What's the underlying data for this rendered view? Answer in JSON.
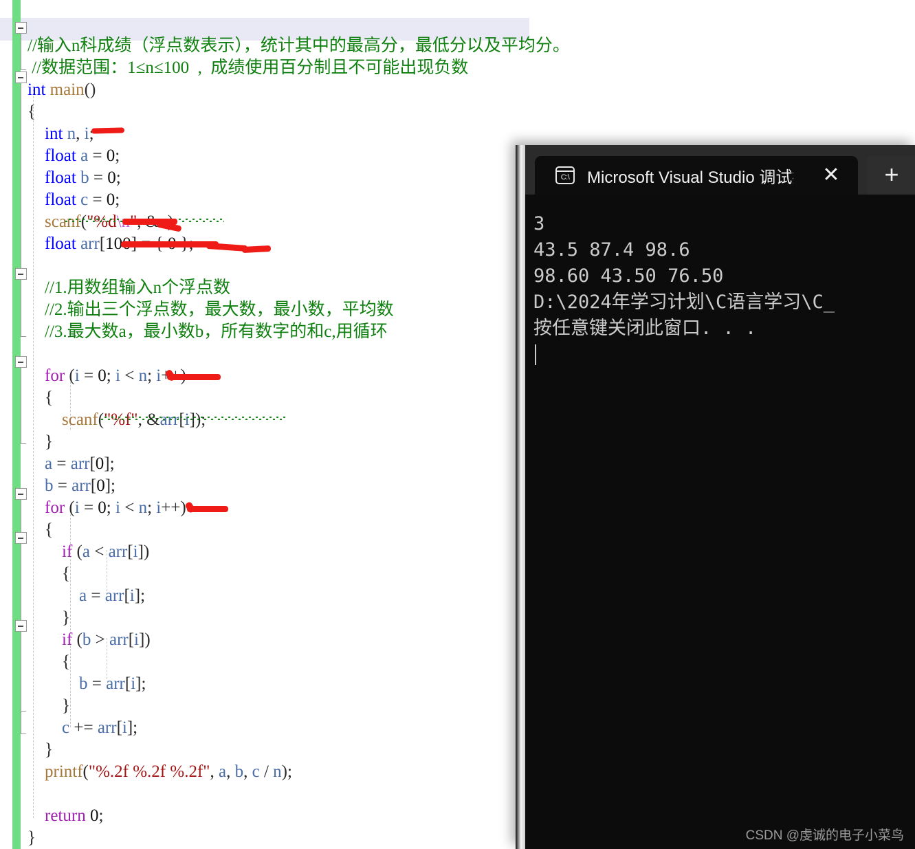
{
  "editor": {
    "name": "visual-studio-code-editor",
    "lines": [
      {
        "indent": 0,
        "tokens": [
          {
            "t": "cmt",
            "s": "//输入n科成绩（浮点数表示），统计其中的最高分，最低分以及平均分。"
          }
        ]
      },
      {
        "indent": 0,
        "tokens": [
          {
            "t": "cmt",
            "s": " //数据范围：1≤n≤100  ,  成绩使用百分制且不可能出现负数"
          }
        ]
      },
      {
        "indent": 0,
        "tokens": [
          {
            "t": "kw",
            "s": "int"
          },
          {
            "t": "fn",
            "s": " main"
          },
          {
            "t": "pun",
            "s": "()"
          }
        ]
      },
      {
        "indent": 0,
        "tokens": [
          {
            "t": "pun",
            "s": "{"
          }
        ]
      },
      {
        "indent": 0,
        "tokens": [
          {
            "t": "kw",
            "s": "    int"
          },
          {
            "t": "var",
            "s": " n"
          },
          {
            "t": "pun",
            "s": ","
          },
          {
            "t": "var",
            "s": " i"
          },
          {
            "t": "pun",
            "s": ";"
          }
        ]
      },
      {
        "indent": 0,
        "tokens": [
          {
            "t": "kw",
            "s": "    float"
          },
          {
            "t": "var",
            "s": " a"
          },
          {
            "t": "pun",
            "s": " = "
          },
          {
            "t": "num",
            "s": "0"
          },
          {
            "t": "pun",
            "s": ";"
          }
        ]
      },
      {
        "indent": 0,
        "tokens": [
          {
            "t": "kw",
            "s": "    float"
          },
          {
            "t": "var",
            "s": " b"
          },
          {
            "t": "pun",
            "s": " = "
          },
          {
            "t": "num",
            "s": "0"
          },
          {
            "t": "pun",
            "s": ";"
          }
        ]
      },
      {
        "indent": 0,
        "tokens": [
          {
            "t": "kw",
            "s": "    float"
          },
          {
            "t": "var",
            "s": " c"
          },
          {
            "t": "pun",
            "s": " = "
          },
          {
            "t": "num",
            "s": "0"
          },
          {
            "t": "pun",
            "s": ";"
          }
        ]
      },
      {
        "indent": 0,
        "tokens": [
          {
            "t": "fn",
            "s": "    scanf"
          },
          {
            "t": "pun",
            "s": "("
          },
          {
            "t": "str",
            "s": "\"%d"
          },
          {
            "t": "esc",
            "s": "\\n"
          },
          {
            "t": "str",
            "s": "\""
          },
          {
            "t": "pun",
            "s": ", &"
          },
          {
            "t": "var",
            "s": "n"
          },
          {
            "t": "pun",
            "s": ");"
          }
        ]
      },
      {
        "indent": 0,
        "tokens": [
          {
            "t": "kw",
            "s": "    float"
          },
          {
            "t": "var",
            "s": " arr"
          },
          {
            "t": "pun",
            "s": "["
          },
          {
            "t": "num",
            "s": "100"
          },
          {
            "t": "pun",
            "s": "] = { "
          },
          {
            "t": "num",
            "s": "0"
          },
          {
            "t": "pun",
            "s": " };"
          }
        ]
      },
      {
        "indent": 0,
        "tokens": []
      },
      {
        "indent": 0,
        "tokens": [
          {
            "t": "cmt",
            "s": "    //1.用数组输入n个浮点数"
          }
        ]
      },
      {
        "indent": 0,
        "tokens": [
          {
            "t": "cmt",
            "s": "    //2.输出三个浮点数，最大数，最小数，平均数"
          }
        ]
      },
      {
        "indent": 0,
        "tokens": [
          {
            "t": "cmt",
            "s": "    //3.最大数a，最小数b，所有数字的和c,用循环"
          }
        ]
      },
      {
        "indent": 0,
        "tokens": []
      },
      {
        "indent": 0,
        "tokens": [
          {
            "t": "ctl",
            "s": "    for"
          },
          {
            "t": "pun",
            "s": " ("
          },
          {
            "t": "var",
            "s": "i"
          },
          {
            "t": "pun",
            "s": " = "
          },
          {
            "t": "num",
            "s": "0"
          },
          {
            "t": "pun",
            "s": "; "
          },
          {
            "t": "var",
            "s": "i"
          },
          {
            "t": "pun",
            "s": " < "
          },
          {
            "t": "var",
            "s": "n"
          },
          {
            "t": "pun",
            "s": "; "
          },
          {
            "t": "var",
            "s": "i"
          },
          {
            "t": "pun",
            "s": "++)"
          }
        ]
      },
      {
        "indent": 0,
        "tokens": [
          {
            "t": "pun",
            "s": "    {"
          }
        ]
      },
      {
        "indent": 0,
        "tokens": [
          {
            "t": "fn",
            "s": "        scanf"
          },
          {
            "t": "pun",
            "s": "("
          },
          {
            "t": "str",
            "s": "\"%f\""
          },
          {
            "t": "pun",
            "s": ", &"
          },
          {
            "t": "var",
            "s": "arr"
          },
          {
            "t": "pun",
            "s": "["
          },
          {
            "t": "var",
            "s": "i"
          },
          {
            "t": "pun",
            "s": "]);"
          }
        ]
      },
      {
        "indent": 0,
        "tokens": [
          {
            "t": "pun",
            "s": "    }"
          }
        ]
      },
      {
        "indent": 0,
        "tokens": [
          {
            "t": "var",
            "s": "    a"
          },
          {
            "t": "pun",
            "s": " = "
          },
          {
            "t": "var",
            "s": "arr"
          },
          {
            "t": "pun",
            "s": "["
          },
          {
            "t": "num",
            "s": "0"
          },
          {
            "t": "pun",
            "s": "];"
          }
        ]
      },
      {
        "indent": 0,
        "tokens": [
          {
            "t": "var",
            "s": "    b"
          },
          {
            "t": "pun",
            "s": " = "
          },
          {
            "t": "var",
            "s": "arr"
          },
          {
            "t": "pun",
            "s": "["
          },
          {
            "t": "num",
            "s": "0"
          },
          {
            "t": "pun",
            "s": "];"
          }
        ]
      },
      {
        "indent": 0,
        "tokens": [
          {
            "t": "ctl",
            "s": "    for"
          },
          {
            "t": "pun",
            "s": " ("
          },
          {
            "t": "var",
            "s": "i"
          },
          {
            "t": "pun",
            "s": " = "
          },
          {
            "t": "num",
            "s": "0"
          },
          {
            "t": "pun",
            "s": "; "
          },
          {
            "t": "var",
            "s": "i"
          },
          {
            "t": "pun",
            "s": " < "
          },
          {
            "t": "var",
            "s": "n"
          },
          {
            "t": "pun",
            "s": "; "
          },
          {
            "t": "var",
            "s": "i"
          },
          {
            "t": "pun",
            "s": "++)"
          }
        ]
      },
      {
        "indent": 0,
        "tokens": [
          {
            "t": "pun",
            "s": "    {"
          }
        ]
      },
      {
        "indent": 0,
        "tokens": [
          {
            "t": "ctl",
            "s": "        if"
          },
          {
            "t": "pun",
            "s": " ("
          },
          {
            "t": "var",
            "s": "a"
          },
          {
            "t": "pun",
            "s": " < "
          },
          {
            "t": "var",
            "s": "arr"
          },
          {
            "t": "pun",
            "s": "["
          },
          {
            "t": "var",
            "s": "i"
          },
          {
            "t": "pun",
            "s": "])"
          }
        ]
      },
      {
        "indent": 0,
        "tokens": [
          {
            "t": "pun",
            "s": "        {"
          }
        ]
      },
      {
        "indent": 0,
        "tokens": [
          {
            "t": "var",
            "s": "            a"
          },
          {
            "t": "pun",
            "s": " = "
          },
          {
            "t": "var",
            "s": "arr"
          },
          {
            "t": "pun",
            "s": "["
          },
          {
            "t": "var",
            "s": "i"
          },
          {
            "t": "pun",
            "s": "];"
          }
        ]
      },
      {
        "indent": 0,
        "tokens": [
          {
            "t": "pun",
            "s": "        }"
          }
        ]
      },
      {
        "indent": 0,
        "tokens": [
          {
            "t": "ctl",
            "s": "        if"
          },
          {
            "t": "pun",
            "s": " ("
          },
          {
            "t": "var",
            "s": "b"
          },
          {
            "t": "pun",
            "s": " > "
          },
          {
            "t": "var",
            "s": "arr"
          },
          {
            "t": "pun",
            "s": "["
          },
          {
            "t": "var",
            "s": "i"
          },
          {
            "t": "pun",
            "s": "])"
          }
        ]
      },
      {
        "indent": 0,
        "tokens": [
          {
            "t": "pun",
            "s": "        {"
          }
        ]
      },
      {
        "indent": 0,
        "tokens": [
          {
            "t": "var",
            "s": "            b"
          },
          {
            "t": "pun",
            "s": " = "
          },
          {
            "t": "var",
            "s": "arr"
          },
          {
            "t": "pun",
            "s": "["
          },
          {
            "t": "var",
            "s": "i"
          },
          {
            "t": "pun",
            "s": "];"
          }
        ]
      },
      {
        "indent": 0,
        "tokens": [
          {
            "t": "pun",
            "s": "        }"
          }
        ]
      },
      {
        "indent": 0,
        "tokens": [
          {
            "t": "var",
            "s": "        c"
          },
          {
            "t": "pun",
            "s": " += "
          },
          {
            "t": "var",
            "s": "arr"
          },
          {
            "t": "pun",
            "s": "["
          },
          {
            "t": "var",
            "s": "i"
          },
          {
            "t": "pun",
            "s": "];"
          }
        ]
      },
      {
        "indent": 0,
        "tokens": [
          {
            "t": "pun",
            "s": "    }"
          }
        ]
      },
      {
        "indent": 0,
        "tokens": [
          {
            "t": "fn",
            "s": "    printf"
          },
          {
            "t": "pun",
            "s": "("
          },
          {
            "t": "str",
            "s": "\"%.2f %.2f %.2f\""
          },
          {
            "t": "pun",
            "s": ", "
          },
          {
            "t": "var",
            "s": "a"
          },
          {
            "t": "pun",
            "s": ", "
          },
          {
            "t": "var",
            "s": "b"
          },
          {
            "t": "pun",
            "s": ", "
          },
          {
            "t": "var",
            "s": "c"
          },
          {
            "t": "pun",
            "s": " / "
          },
          {
            "t": "var",
            "s": "n"
          },
          {
            "t": "pun",
            "s": ");"
          }
        ]
      },
      {
        "indent": 0,
        "tokens": []
      },
      {
        "indent": 0,
        "tokens": [
          {
            "t": "ctl",
            "s": "    return"
          },
          {
            "t": "num",
            "s": " 0"
          },
          {
            "t": "pun",
            "s": ";"
          }
        ]
      },
      {
        "indent": 0,
        "tokens": [
          {
            "t": "pun",
            "s": "}"
          }
        ]
      }
    ],
    "colors": {
      "comment": "#108010",
      "keyword": "#0000ff",
      "control": "#a020b0",
      "string": "#a31515",
      "function": "#a8783b",
      "variable": "#4b6ea8",
      "change_bar": "#6fdd84",
      "annotation_red": "#ef1b17"
    }
  },
  "console": {
    "tab_title": "Microsoft Visual Studio 调试控",
    "icon": "terminal-cmd-icon",
    "close_label": "✕",
    "newtab_label": "+",
    "output": [
      "3",
      "43.5 87.4 98.6",
      "98.60 43.50 76.50",
      "D:\\2024年学习计划\\C语言学习\\C_",
      "按任意键关闭此窗口. . ."
    ]
  },
  "watermark": {
    "text": "CSDN @虔诚的电子小菜鸟"
  }
}
